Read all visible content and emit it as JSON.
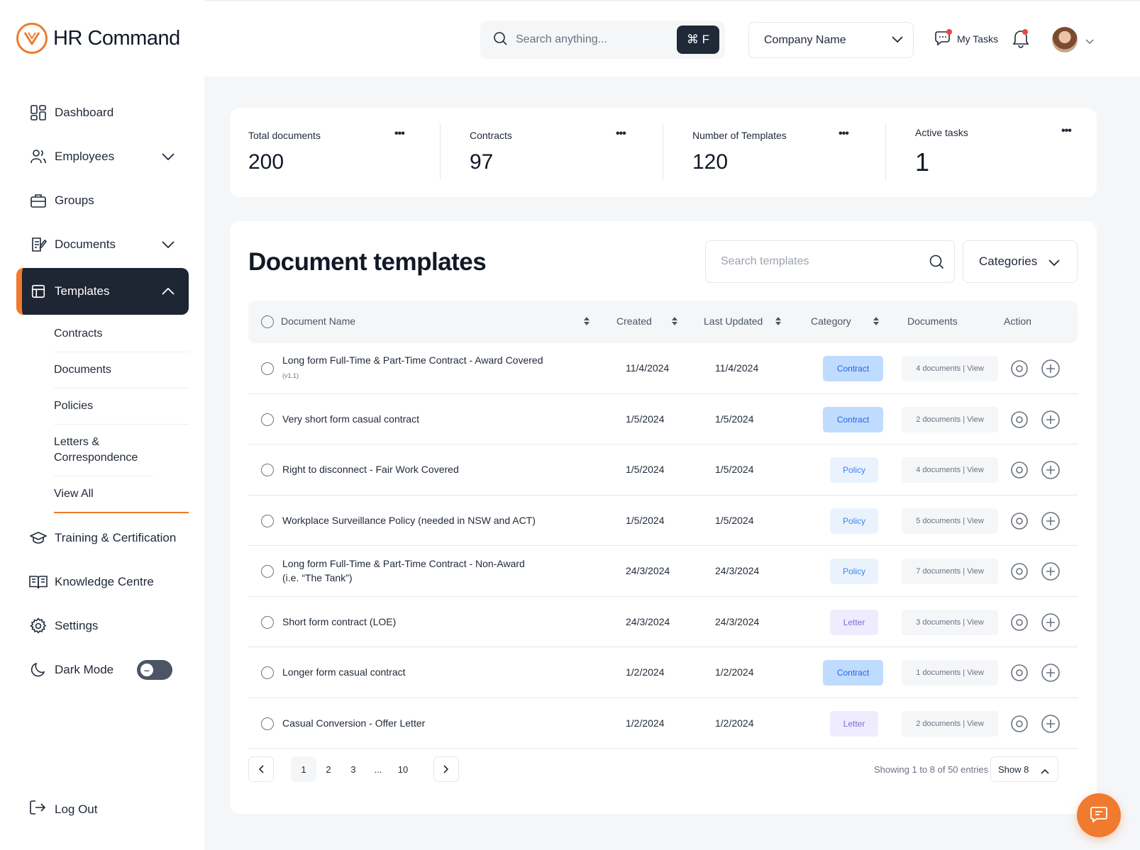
{
  "brand": {
    "name": "HR Command",
    "accent": "#f07a2e"
  },
  "sidebar": {
    "items": [
      {
        "label": "Dashboard",
        "icon": "dashboard-grid-icon"
      },
      {
        "label": "Employees",
        "icon": "users-icon",
        "expandable": true
      },
      {
        "label": "Groups",
        "icon": "briefcase-icon"
      },
      {
        "label": "Documents",
        "icon": "document-edit-icon",
        "expandable": true
      },
      {
        "label": "Templates",
        "icon": "layout-icon",
        "expandable": true,
        "active": true
      }
    ],
    "subitems": [
      "Contracts",
      "Documents",
      "Policies",
      "Letters & Correspondence",
      "View All"
    ],
    "items_after": [
      {
        "label": "Training & Certification",
        "icon": "graduation-cap-icon"
      },
      {
        "label": "Knowledge Centre",
        "icon": "book-open-icon"
      },
      {
        "label": "Settings",
        "icon": "gear-icon"
      }
    ],
    "dark_mode_label": "Dark Mode",
    "logout_label": "Log Out"
  },
  "topbar": {
    "search_placeholder": "Search anything...",
    "shortcut": "⌘ F",
    "company": "Company Name",
    "my_tasks": "My Tasks"
  },
  "stats": [
    {
      "label": "Total documents",
      "value": "200"
    },
    {
      "label": "Contracts",
      "value": "97"
    },
    {
      "label": "Number of Templates",
      "value": "120"
    },
    {
      "label": "Active tasks",
      "value": "1"
    }
  ],
  "panel": {
    "title": "Document templates",
    "search_placeholder": "Search templates",
    "categories_label": "Categories"
  },
  "table": {
    "headers": {
      "name": "Document Name",
      "created": "Created",
      "updated": "Last Updated",
      "category": "Category",
      "documents": "Documents",
      "action": "Action"
    },
    "rows": [
      {
        "name": "Long form Full-Time & Part-Time Contract - Award Covered",
        "version": "(v1.1)",
        "created": "11/4/2024",
        "updated": "11/4/2024",
        "category": "Contract",
        "docs": "4 documents | View"
      },
      {
        "name": "Very short form casual contract",
        "version": "",
        "created": "1/5/2024",
        "updated": "1/5/2024",
        "category": "Contract",
        "docs": "2 documents | View"
      },
      {
        "name": "Right to disconnect - Fair Work Covered",
        "version": "",
        "created": "1/5/2024",
        "updated": "1/5/2024",
        "category": "Policy",
        "docs": "4 documents | View"
      },
      {
        "name": "Workplace Surveillance Policy (needed in NSW and ACT)",
        "version": "",
        "created": "1/5/2024",
        "updated": "1/5/2024",
        "category": "Policy",
        "docs": "5 documents | View"
      },
      {
        "name": "Long form Full-Time  & Part-Time Contract - Non-Award (i.e. “The Tank”)",
        "version": "",
        "created": "24/3/2024",
        "updated": "24/3/2024",
        "category": "Policy",
        "docs": "7 documents | View"
      },
      {
        "name": "Short form contract (LOE)",
        "version": "",
        "created": "24/3/2024",
        "updated": "24/3/2024",
        "category": "Letter",
        "docs": "3 documents | View"
      },
      {
        "name": "Longer form casual contract",
        "version": "",
        "created": "1/2/2024",
        "updated": "1/2/2024",
        "category": "Contract",
        "docs": "1 documents | View"
      },
      {
        "name": "Casual Conversion -  Offer Letter",
        "version": "",
        "created": "1/2/2024",
        "updated": "1/2/2024",
        "category": "Letter",
        "docs": "2 documents | View"
      }
    ]
  },
  "pagination": {
    "pages": [
      "1",
      "2",
      "3",
      "...",
      "10"
    ],
    "current": "1",
    "showing": "Showing 1 to 8 of 50 entries",
    "page_size": "Show 8"
  }
}
